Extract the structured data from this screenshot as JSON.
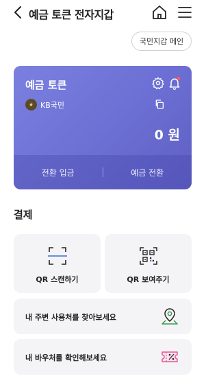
{
  "header": {
    "title": "예금 토큰 전자지갑",
    "back_icon": "chevron-left-icon",
    "home_icon": "home-icon",
    "menu_icon": "hamburger-menu-icon"
  },
  "main_wallet_button": {
    "label": "국민지갑 메인"
  },
  "card": {
    "title": "예금 토큰",
    "bank": {
      "logo_text": "★",
      "name": "KB국민"
    },
    "balance": "0 원",
    "gradient_colors": [
      "#7b80e0",
      "#5f5fc4"
    ],
    "notification_dot_color": "#ff5a5a",
    "footer": {
      "left_label": "전환 입금",
      "right_label": "예금 전환"
    }
  },
  "payment": {
    "section_title": "결제",
    "qr_scan_label": "QR 스캔하기",
    "qr_show_label": "QR 보여주기",
    "find_merchants_label": "내 주변 사용처를 찾아보세요",
    "check_vouchers_label": "내 바우처를 확인해보세요"
  },
  "colors": {
    "accent_green": "#3c9a4a",
    "accent_pink": "#e8579a"
  }
}
